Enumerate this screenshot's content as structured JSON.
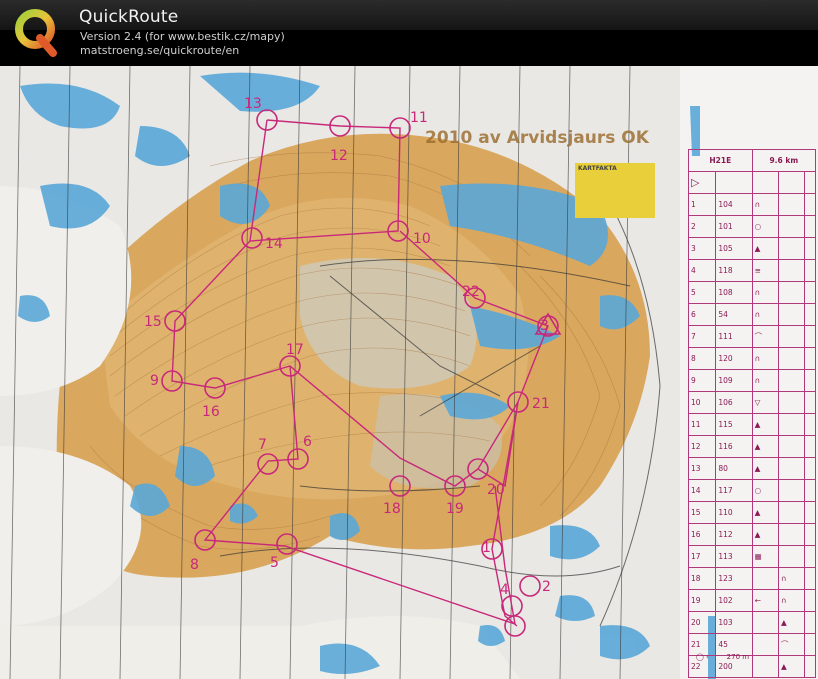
{
  "app": {
    "title": "QuickRoute",
    "version": "Version 2.4  (for www.bestik.cz/mapy)",
    "link": "matstroeng.se/quickroute/en",
    "logo_letter": "Q"
  },
  "map": {
    "title": "2010 av Arvidsjaurs OK",
    "legend_title": "KARTFAKTA",
    "controls": [
      {
        "label": "13"
      },
      {
        "label": "11"
      },
      {
        "label": "12"
      },
      {
        "label": "14"
      },
      {
        "label": "10"
      },
      {
        "label": "15"
      },
      {
        "label": "22"
      },
      {
        "label": "3"
      },
      {
        "label": "17"
      },
      {
        "label": "9"
      },
      {
        "label": "16"
      },
      {
        "label": "21"
      },
      {
        "label": "6"
      },
      {
        "label": "7"
      },
      {
        "label": "18"
      },
      {
        "label": "19"
      },
      {
        "label": "20"
      },
      {
        "label": "8"
      },
      {
        "label": "5"
      },
      {
        "label": "1"
      },
      {
        "label": "2"
      },
      {
        "label": "4"
      }
    ]
  },
  "description_sheet": {
    "class": "H21E",
    "distance": "9.6 km",
    "rows": [
      {
        "n": "1",
        "code": "104"
      },
      {
        "n": "2",
        "code": "101"
      },
      {
        "n": "3",
        "code": "105"
      },
      {
        "n": "4",
        "code": "118"
      },
      {
        "n": "5",
        "code": "108"
      },
      {
        "n": "6",
        "code": "54"
      },
      {
        "n": "7",
        "code": "111"
      },
      {
        "n": "8",
        "code": "120"
      },
      {
        "n": "9",
        "code": "109"
      },
      {
        "n": "10",
        "code": "106"
      },
      {
        "n": "11",
        "code": "115"
      },
      {
        "n": "12",
        "code": "116"
      },
      {
        "n": "13",
        "code": "80"
      },
      {
        "n": "14",
        "code": "117"
      },
      {
        "n": "15",
        "code": "110"
      },
      {
        "n": "16",
        "code": "112"
      },
      {
        "n": "17",
        "code": "113"
      },
      {
        "n": "18",
        "code": "123"
      },
      {
        "n": "19",
        "code": "102"
      },
      {
        "n": "20",
        "code": "103"
      },
      {
        "n": "21",
        "code": "45"
      },
      {
        "n": "22",
        "code": "200"
      }
    ],
    "finish": "270 m"
  },
  "colors": {
    "course": "#c8287a",
    "map_orange": "#d9a75e",
    "water": "#5aa7d8",
    "paper": "#f3f2ef"
  }
}
